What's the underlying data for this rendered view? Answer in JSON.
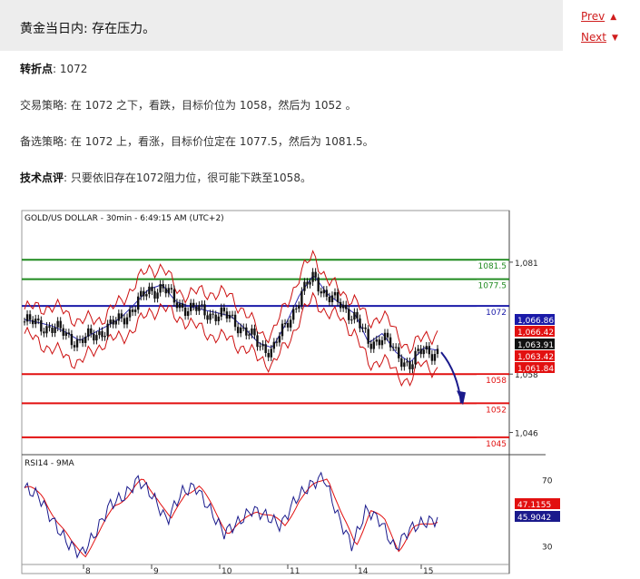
{
  "article": {
    "title": "黄金当日内: 存在压力。",
    "prev_label": "Prev",
    "next_label": "Next",
    "pivot_label": "转折点",
    "pivot_value": ": 1072",
    "strategy_label": "交易策略",
    "strategy_text": ": 在 1072 之下，看跌，目标价位为 1058，然后为 1052 。",
    "alt_label": "备选策略",
    "alt_text": ": 在 1072 上，看涨，目标价位定在 1077.5，然后为 1081.5。",
    "comment_label": "技术点评",
    "comment_text": ": 只要依旧存在1072阻力位，很可能下跌至1058。"
  },
  "colors": {
    "accent_red": "#d01d1d",
    "support_red": "#e21010",
    "resistance_green": "#1f8a1f",
    "pivot_blue": "#1a1aa8"
  },
  "chart_data": [
    {
      "type": "line",
      "title": "GOLD/US DOLLAR - 30min - 6:49:15 AM (UTC+2)",
      "x_tick_labels": [
        "8",
        "9",
        "10",
        "11",
        "14",
        "15"
      ],
      "y_tick_labels": [
        "1,081",
        "1,058",
        "1,046"
      ],
      "ylim": [
        1042,
        1089
      ],
      "price_path": [
        1068.8,
        1068.2,
        1067.5,
        1066.2,
        1064.5,
        1066.0,
        1067.5,
        1069.2,
        1072.0,
        1075.0,
        1076.0,
        1072.5,
        1071.5,
        1070.8,
        1070.2,
        1069.5,
        1067.0,
        1064.0,
        1063.0,
        1068.0,
        1074.0,
        1078.0,
        1074.0,
        1072.0,
        1070.0,
        1064.0,
        1066.0,
        1062.0,
        1060.0,
        1063.0,
        1062.5
      ],
      "levels": [
        {
          "label": "1081.5",
          "value": 1081.5,
          "kind": "resistance"
        },
        {
          "label": "1077.5",
          "value": 1077.5,
          "kind": "resistance"
        },
        {
          "label": "1072",
          "value": 1072,
          "kind": "pivot"
        },
        {
          "label": "1058",
          "value": 1058,
          "kind": "support"
        },
        {
          "label": "1052",
          "value": 1052,
          "kind": "support"
        },
        {
          "label": "1045",
          "value": 1045,
          "kind": "support"
        }
      ],
      "price_tags": [
        {
          "label": "1,066.86",
          "color": "#1a1aa8"
        },
        {
          "label": "1,066.42",
          "color": "#e21010"
        },
        {
          "label": "1,063.91",
          "color": "#111111"
        },
        {
          "label": "1,063.42",
          "color": "#e21010"
        },
        {
          "label": "1,061.84",
          "color": "#e21010"
        }
      ],
      "forecast_arrow": {
        "from": 1062.5,
        "to": 1052
      }
    },
    {
      "type": "line",
      "title": "RSI14 - 9MA",
      "y_tick_labels": [
        "70",
        "30"
      ],
      "ylim": [
        20,
        80
      ],
      "rsi_path": [
        65,
        60,
        45,
        32,
        25,
        38,
        55,
        60,
        70,
        60,
        45,
        62,
        66,
        52,
        38,
        44,
        52,
        48,
        42,
        58,
        66,
        72,
        48,
        30,
        52,
        45,
        28,
        40,
        44,
        46
      ],
      "series": [
        {
          "name": "RSI14",
          "value_label": "45.9042",
          "color": "#1a1a8c"
        },
        {
          "name": "9MA",
          "value_label": "47.1155",
          "color": "#e21010"
        }
      ]
    }
  ]
}
